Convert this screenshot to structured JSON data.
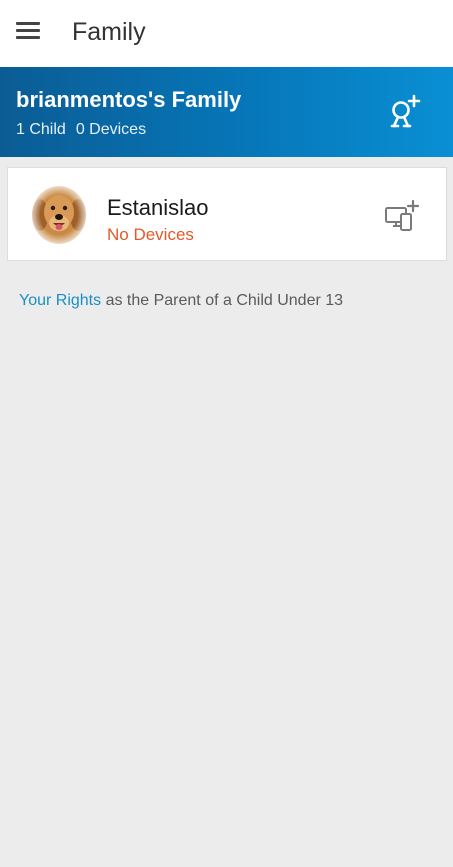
{
  "appbar": {
    "title": "Family",
    "menu_icon": "hamburger-menu-icon"
  },
  "family": {
    "title": "brianmentos's Family",
    "child_count": "1 Child",
    "device_count": "0 Devices",
    "add_child_icon": "add-child-icon",
    "gradient_colors": [
      "#0b5c94",
      "#0a8fd4"
    ]
  },
  "children": [
    {
      "name": "Estanislao",
      "status": "No Devices",
      "status_color": "#e05a2a",
      "avatar": "dog-avatar",
      "add_device_icon": "add-device-icon"
    }
  ],
  "rights": {
    "link_text": "Your Rights",
    "text": " as the Parent of a Child Under 13"
  },
  "colors": {
    "background": "#ececec",
    "link": "#1a8fc4"
  }
}
